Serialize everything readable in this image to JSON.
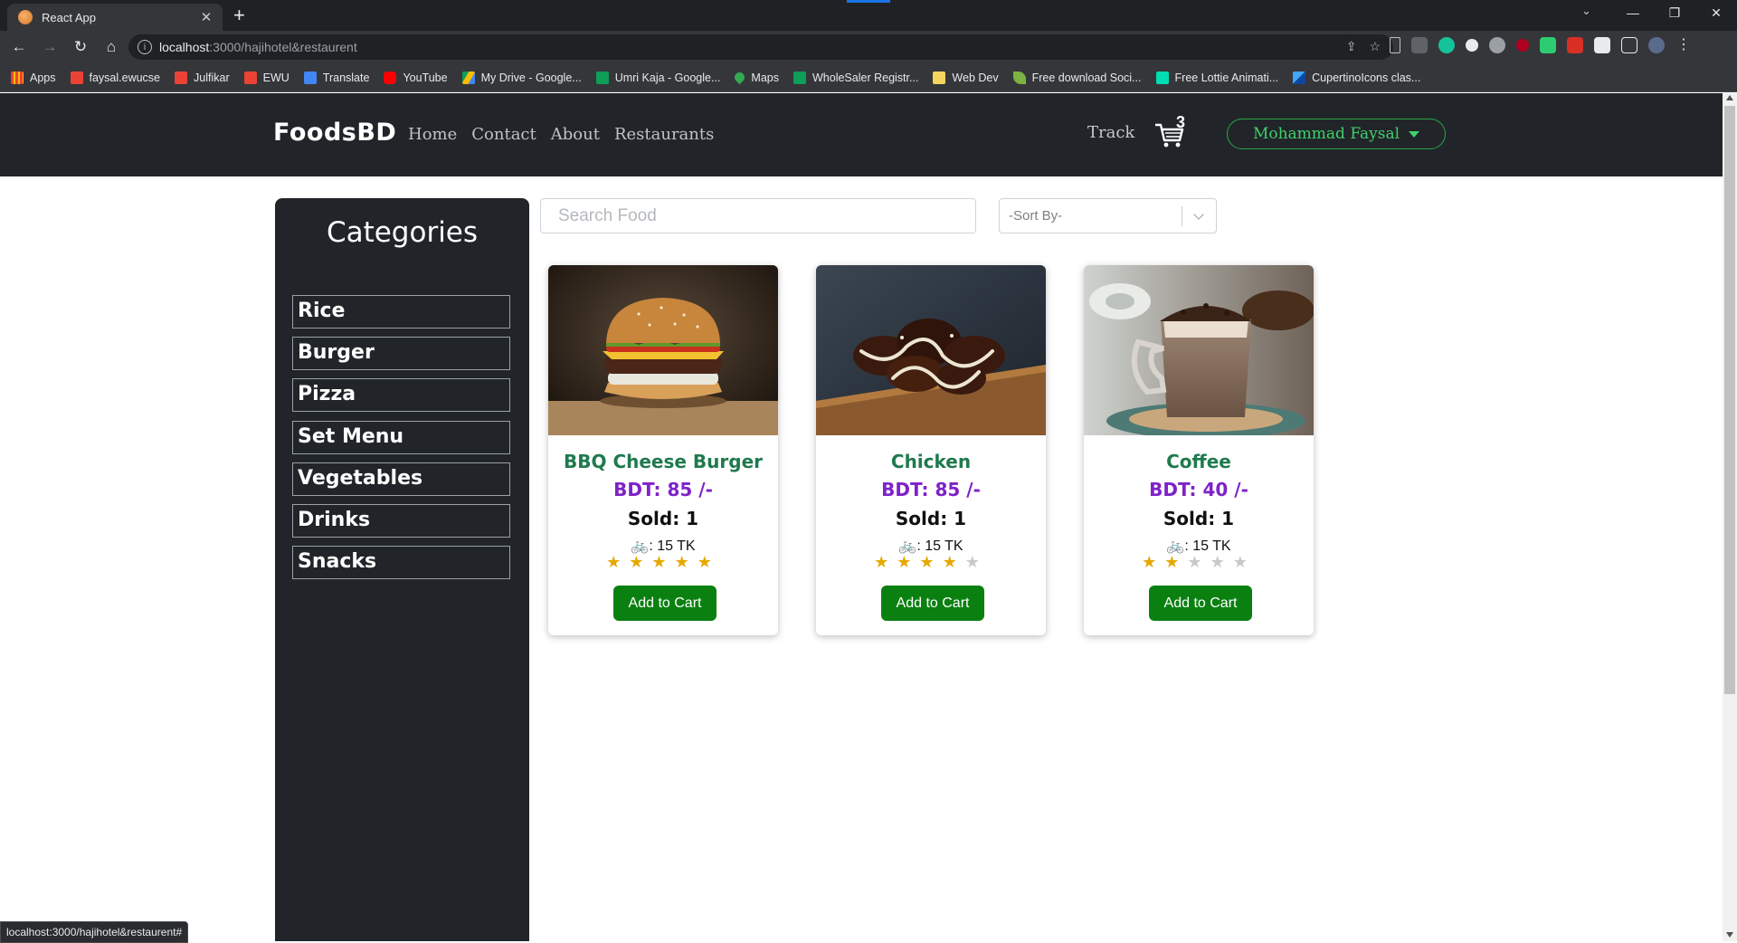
{
  "browser": {
    "tab_title": "React App",
    "new_tab": "+",
    "tab_close": "✕",
    "url_host": "localhost",
    "url_path": ":3000/hajihotel&restaurent",
    "status_url": "localhost:3000/hajihotel&restaurent#",
    "bookmarks": [
      {
        "label": "Apps",
        "icon": "apps-grid-icon",
        "color": "#ea4335"
      },
      {
        "label": "faysal.ewucse",
        "icon": "gmail-icon",
        "color": "#ea4335"
      },
      {
        "label": "Julfikar",
        "icon": "gmail-icon",
        "color": "#ea4335"
      },
      {
        "label": "EWU",
        "icon": "gmail-icon",
        "color": "#ea4335"
      },
      {
        "label": "Translate",
        "icon": "translate-icon",
        "color": "#4285f4"
      },
      {
        "label": "YouTube",
        "icon": "youtube-icon",
        "color": "#ff0000"
      },
      {
        "label": "My Drive - Google...",
        "icon": "drive-icon",
        "color": "#fbbc04"
      },
      {
        "label": "Umri Kaja - Google...",
        "icon": "sheets-icon",
        "color": "#0f9d58"
      },
      {
        "label": "Maps",
        "icon": "maps-icon",
        "color": "#34a853"
      },
      {
        "label": "WholeSaler Registr...",
        "icon": "sheets-icon",
        "color": "#0f9d58"
      },
      {
        "label": "Web Dev",
        "icon": "folder-icon",
        "color": "#f4d35e"
      },
      {
        "label": "Free download Soci...",
        "icon": "leaf-icon",
        "color": "#7cb342"
      },
      {
        "label": "Free Lottie Animati...",
        "icon": "lottie-icon",
        "color": "#00ddb3"
      },
      {
        "label": "CupertinoIcons clas...",
        "icon": "flutter-icon",
        "color": "#42a5f5"
      }
    ]
  },
  "navbar": {
    "brand": "FoodsBD",
    "links": [
      "Home",
      "Contact",
      "About",
      "Restaurants"
    ],
    "track": "Track",
    "cart_count": "3",
    "user_name": "Mohammad Faysal"
  },
  "sidebar": {
    "title": "Categories",
    "categories": [
      "Rice",
      "Burger",
      "Pizza",
      "Set Menu",
      "Vegetables",
      "Drinks",
      "Snacks"
    ]
  },
  "filters": {
    "search_placeholder": "Search Food",
    "sort_placeholder": "-Sort By-"
  },
  "products": [
    {
      "name": "BBQ Cheese Burger",
      "price": "BDT: 85 /-",
      "sold": "Sold: 1",
      "delivery": ": 15 TK",
      "rating": 5,
      "button": "Add to Cart",
      "image": "burger-photo"
    },
    {
      "name": "Chicken",
      "price": "BDT: 85 /-",
      "sold": "Sold: 1",
      "delivery": ": 15 TK",
      "rating": 4,
      "button": "Add to Cart",
      "image": "chicken-wings-photo"
    },
    {
      "name": "Coffee",
      "price": "BDT: 40 /-",
      "sold": "Sold: 1",
      "delivery": ": 15 TK",
      "rating": 2,
      "button": "Add to Cart",
      "image": "coffee-mug-photo"
    }
  ],
  "rating_max": 5,
  "colors": {
    "navbar_bg": "#212529",
    "product_name": "#1f7a4d",
    "price": "#7e22c9",
    "cart_button": "#0a8011",
    "user_button": "#3fd06a",
    "star": "#e6a800"
  }
}
